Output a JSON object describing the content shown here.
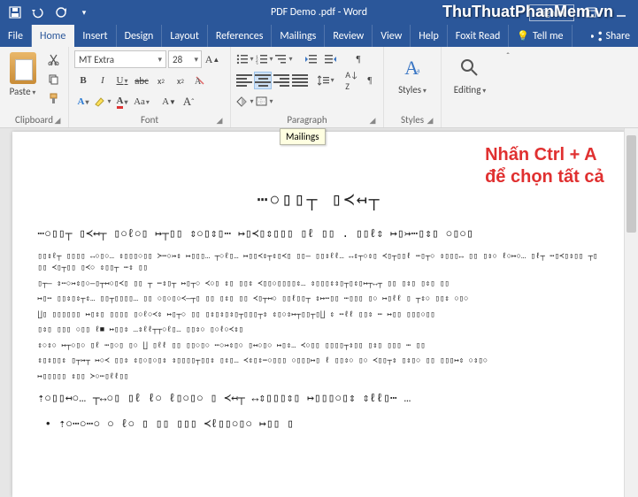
{
  "titlebar": {
    "doc_title": "PDF Demo .pdf - Word",
    "sign_in": "Sign in",
    "qat": {
      "save": "save-icon",
      "undo": "undo-icon",
      "redo": "redo-icon",
      "customize": "customize-qat-icon"
    }
  },
  "watermark": "ThuThuatPhanMem.vn",
  "tabs": {
    "file": "File",
    "home": "Home",
    "insert": "Insert",
    "design": "Design",
    "layout": "Layout",
    "references": "References",
    "mailings": "Mailings",
    "review": "Review",
    "view": "View",
    "help": "Help",
    "foxit": "Foxit Read",
    "tell_me": "Tell me",
    "share": "Share",
    "active": "home"
  },
  "ribbon": {
    "clipboard": {
      "label": "Clipboard",
      "paste": "Paste"
    },
    "font": {
      "label": "Font",
      "name": "MT Extra",
      "size": "28"
    },
    "paragraph": {
      "label": "Paragraph"
    },
    "styles": {
      "label": "Styles",
      "button": "Styles"
    },
    "editing": {
      "label": "",
      "button": "Editing"
    }
  },
  "tooltip": "Mailings",
  "annotation": {
    "line1": "Nhấn Ctrl + A",
    "line2": "để chọn tất cả"
  },
  "document": {
    "title": "⋯○▯▯┬ ▯≺↤┬",
    "p1": "⋯○▯▯┬ ▯≺↤┬ ▯○ℓ○▯ ↦┬▯▯ ⇕○▯⇕▯⋯   ↦▯≺▯⇕▯▯▯ ▯ℓ ▯▯ . ▯▯ℓ⇕ ↦▯↣⋯▯⇕▯   ○▯○▯",
    "s1": "▯▯⇕ℓ┬ ▯▯▯▯ ↔○▯○… ⇕▯▯▯○▯▯ ≻⋯○↣⇕ ↦▯▯▯… ┬○ℓ▯… ↦▯▯≺⇕┬⇕▯≺▯ ▯▯― ▯▯⇕ℓℓ… ↔⇕┬○⇕▯ ≺▯┬▯▯ℓ ⋯▯┬○ ⇕▯▯▯↔ ▯▯ ▯⇕○ ℓ○↦○… ▯ℓ┬ ⋯▯≺▯⇕▯▯ ┬▯▯▯ ≺▯┬▯▯ ▯≺○ ⇕▯▯┬ ⋯⇕ ▯▯",
    "s2": "▯┬― ⇕⋯○↣⇕▯○―▯┬↤○▯≺▯ ▯▯ ┬ ⋯⇕▯┬ ↦▯┬○ ≺○▯ ⇕▯ ▯▯⇕ ≺▯▯○▯▯▯▯⇕… ⇕▯▯▯⇕⇕▯┬▯⇕▯↦┬↔┬ ▯▯ ▯⇕▯ ▯⇕▯ ▯▯",
    "s3": "↦▯⋯  ▯▯⇕▯⇕┬⇕… ▯▯┬▯▯▯▯… ▯▯ ○▯○▯○≺―┬▯ ▯▯ ▯⇕▯ ▯▯ ≺▯┬↤○ ▯▯ℓ▯▯┬ ⇕↦⋯▯▯ ⋯▯▯▯ ▯○ ↦▯ℓℓ ▯ ┬⇕○ ▯▯⇕ ○▯○",
    "s4": "∐▯ ▯▯▯▯▯▯ ↦▯⇕▯ ▯▯▯▯ ▯○ℓ○≺⇕ ↦▯┬○ ▯▯  ▯⇕▯⇕▯⇕▯┬▯▯▯┬⇕ ⇕▯○⇕↦┬▯▯┬▯∐ ⇕ ⋯ℓℓ ▯▯⇕ ⋯ ↦▯▯ ▯▯▯○▯▯",
    "s5": "▯⇕▯ ▯▯▯ ○▯▯ ℓ■ ↦▯▯⇕  …⇕ℓℓ┬┬○ℓ▯…  ▯▯⇕○ ▯○ℓ○≺⇕▯",
    "s6": "⇕○⇕○ ↦┬○▯○  ▯ℓ ⋯▯○▯ ▯○  ∐ ▯ℓℓ ▯▯ ▯▯○▯○ ⋯○↣⇕▯○ ▯↤○▯○  ↦▯⇕… ≺○▯▯ ▯▯▯▯┬⇕▯▯ ▯⇕▯ ▯▯▯ ⋯ ▯▯",
    "s7": "⇕▯⇕▯▯⇕ ▯┬↣┬ ↦○≺ ▯▯⇕ ⇕▯○▯○▯⇕ ⇕▯▯▯▯┬▯▯⇕ ▯⇕▯… ≺⇕▯⇕⋯○▯▯▯ ○▯▯▯↦▯ ℓ ▯▯⇕○ ▯○ ≺▯▯┬⇕ ▯⇕▯○ ▯▯ ▯▯▯↦⇕ ○⇕▯○",
    "s8": "↦▯▯▯▯▯ ⇕▯▯  ≻○⋯▯ℓℓ▯▯",
    "p2": "⇡○▯▯↤○… ┬↔○▯  ▯ℓ ℓ○ ℓ▯○▯○ ▯ ≺↤┬ ↔⇕▯▯▯⇕▯ ↦▯▯▯○▯⇕ ⇕ℓℓ▯⋯ …",
    "bullet1": "⇡○⋯○⋯○   ○ ℓ○ ▯ ▯▯  ▯▯▯  ≺ℓ▯▯○▯○  ↦▯▯ ▯"
  }
}
